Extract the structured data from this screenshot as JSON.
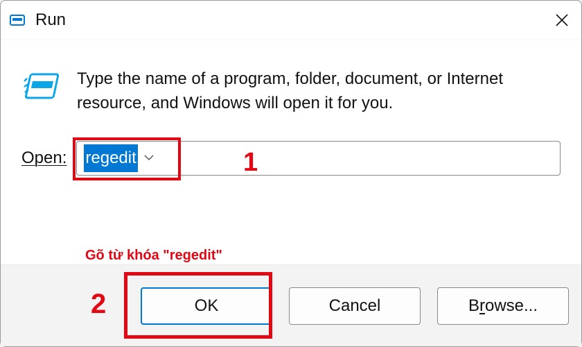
{
  "titlebar": {
    "title": "Run"
  },
  "content": {
    "description": "Type the name of a program, folder, document, or Internet resource, and Windows will open it for you.",
    "open_label": "Open:",
    "input_value": "regedit"
  },
  "footer": {
    "ok_label": "OK",
    "cancel_label": "Cancel",
    "browse_label_pre": "B",
    "browse_label_u": "r",
    "browse_label_post": "owse..."
  },
  "annotations": {
    "callout1": "1",
    "callout2": "2",
    "hint": "Gõ từ khóa \"regedit\"",
    "colors": {
      "highlight": "#e30613",
      "selection": "#0078d4"
    }
  }
}
